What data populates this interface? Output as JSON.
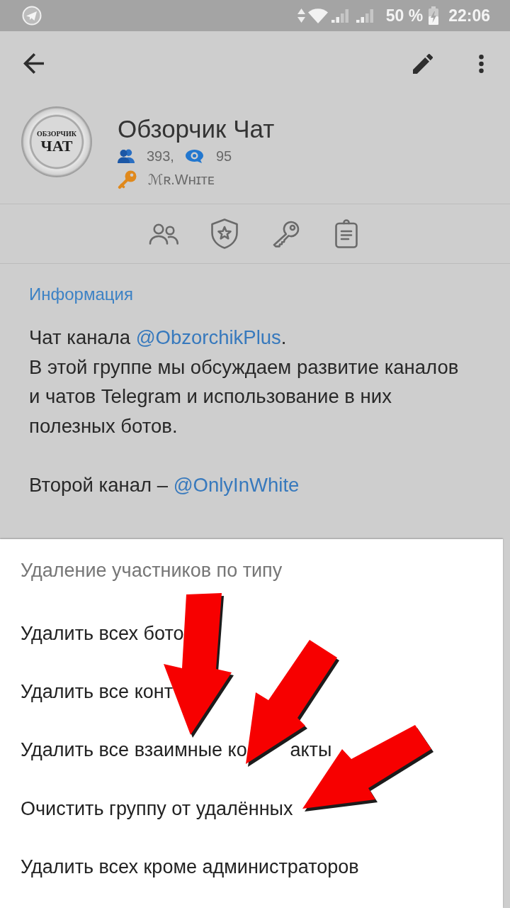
{
  "status_bar": {
    "battery": "50 %",
    "time": "22:06"
  },
  "chat": {
    "avatar_logo": [
      "ОБЗОРЧИК",
      "ЧАТ"
    ],
    "title": "Обзорчик Чат",
    "members": "393,",
    "online": "95",
    "owner": "ℳʀ.Wʜɪᴛᴇ"
  },
  "info": {
    "heading": "Информация",
    "paragraphs": [
      {
        "lines": [
          [
            {
              "kind": "text",
              "text": "Чат канала "
            },
            {
              "kind": "link",
              "text": "@ObzorchikPlus"
            },
            {
              "kind": "text",
              "text": "."
            }
          ],
          [
            {
              "kind": "text",
              "text": "В этой группе мы обсуждаем развитие каналов"
            }
          ],
          [
            {
              "kind": "text",
              "text": "и чатов Telegram и использование в них"
            }
          ],
          [
            {
              "kind": "text",
              "text": "полезных ботов."
            }
          ]
        ]
      },
      {
        "lines": [
          [
            {
              "kind": "text",
              "text": "Второй канал – "
            },
            {
              "kind": "link",
              "text": "@OnlyInWhite"
            }
          ]
        ]
      }
    ]
  },
  "dialog": {
    "title": "Удаление участников по типу",
    "items": [
      {
        "parts": [
          "Удалить всех бото"
        ]
      },
      {
        "parts": [
          "Удалить все конт"
        ]
      },
      {
        "parts": [
          "Удалить все взаимные ко",
          "акты"
        ]
      },
      {
        "parts": [
          "Очистить группу от удалённых"
        ]
      },
      {
        "parts": [
          "Удалить всех кроме администраторов"
        ]
      }
    ]
  }
}
